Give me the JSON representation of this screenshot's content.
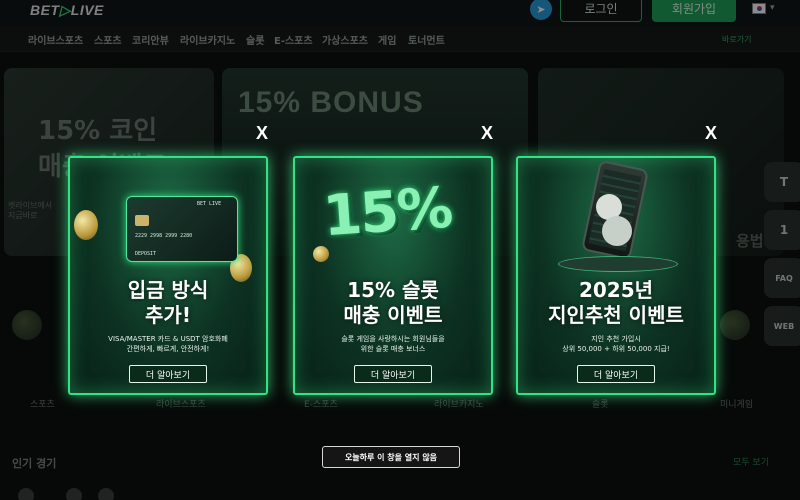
{
  "header": {
    "logo_prefix": "BET",
    "logo_suffix": "LIVE",
    "login_label": "로그인",
    "join_label": "회원가입",
    "language": "KR"
  },
  "nav": {
    "items": [
      "라이브스포츠",
      "스포츠",
      "코리안뷰",
      "라이브카지노",
      "슬롯",
      "E-스포츠",
      "가상스포츠",
      "게임",
      "토너먼트"
    ],
    "right_label": "바로가기"
  },
  "background": {
    "left_banner": {
      "line1": "15% 코인",
      "line2": "매충 이벤트",
      "small1": "벳라이브에서",
      "small2": "지금바로"
    },
    "center_banner": {
      "title": "15% BONUS"
    },
    "right_banner": {
      "text": "용법"
    },
    "categories": [
      "스포츠",
      "라이브스포츠",
      "E-스포츠",
      "라이브카지노",
      "슬롯",
      "미니게임"
    ],
    "section_title": "인기 경기",
    "see_all": "모두 보기",
    "side_buttons": [
      "T",
      "1",
      "FAQ",
      "WEB"
    ]
  },
  "popups": [
    {
      "title_line1": "입금 방식",
      "title_line2": "추가!",
      "desc_line1": "VISA/MASTER 카드 & USDT 암호화폐",
      "desc_line2": "간편하게, 빠르게, 안전하게!",
      "button": "더 알아보기",
      "card_brand": "BET LIVE",
      "card_number": "2229 2998 2999 2280",
      "card_deposit": "DEPOSIT"
    },
    {
      "title_line1": "15% 슬롯",
      "title_line2": "매충 이벤트",
      "desc_line1": "슬롯 게임을 사랑하시는 회원님들을",
      "desc_line2": "위한 슬롯 매충 보너스",
      "button": "더 알아보기",
      "art_text": "15%"
    },
    {
      "title_line1": "2025년",
      "title_line2": "지인추천 이벤트",
      "desc_line1": "지인 추천 가입시",
      "desc_line2": "상위 50,000 + 하위 50,000 지급!",
      "button": "더 알아보기"
    }
  ],
  "close_label": "X",
  "dont_show_today": "오늘하루 이 창을 열지 않음",
  "colors": {
    "accent": "#35e283",
    "popup_bg": "#0d3222",
    "join_button": "#20a55a",
    "telegram": "#2a9de0"
  }
}
